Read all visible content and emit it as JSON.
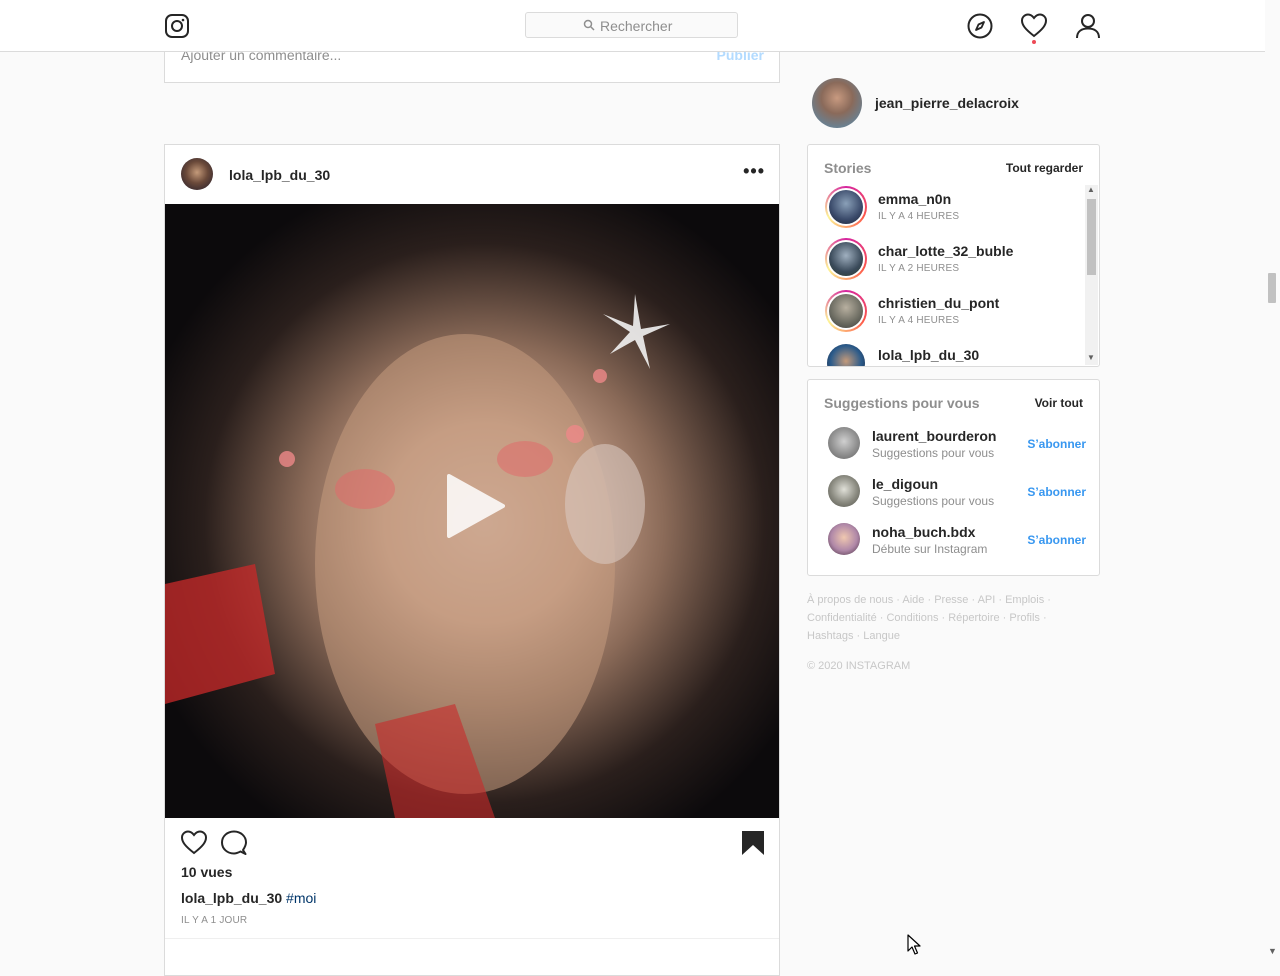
{
  "header": {
    "search_placeholder": "Rechercher",
    "icons": [
      "instagram-logo-icon",
      "compass-icon",
      "heart-icon",
      "user-icon"
    ]
  },
  "prev_post": {
    "comment_placeholder": "Ajouter un commentaire...",
    "publish_label": "Publier"
  },
  "post": {
    "username": "lola_lpb_du_30",
    "more_label": "···",
    "views": "10 vues",
    "caption_user": "lola_lpb_du_30",
    "caption_tag": "#moi",
    "time": "IL Y A 1 JOUR"
  },
  "me": {
    "username": "jean_pierre_delacroix"
  },
  "stories": {
    "title": "Stories",
    "link": "Tout regarder",
    "items": [
      {
        "name": "emma_n0n",
        "time": "IL Y A 4 HEURES"
      },
      {
        "name": "char_lotte_32_buble",
        "time": "IL Y A 2 HEURES"
      },
      {
        "name": "christien_du_pont",
        "time": "IL Y A 4 HEURES"
      },
      {
        "name": "lola_lpb_du_30",
        "time": ""
      }
    ]
  },
  "suggestions": {
    "title": "Suggestions pour vous",
    "link": "Voir tout",
    "items": [
      {
        "name": "laurent_bourderon",
        "sub": "Suggestions pour vous",
        "action": "S’abonner"
      },
      {
        "name": "le_digoun",
        "sub": "Suggestions pour vous",
        "action": "S’abonner"
      },
      {
        "name": "noha_buch.bdx",
        "sub": "Débute sur Instagram",
        "action": "S’abonner"
      }
    ]
  },
  "footer": {
    "line1": "À propos de nous · Aide · Presse · API · Emplois ·",
    "line2": "Confidentialité · Conditions · Répertoire · Profils ·",
    "line3": "Hashtags · Langue",
    "copyright": "© 2020 INSTAGRAM"
  },
  "colors": {
    "link_blue": "#3897f0",
    "hashtag": "#003569",
    "border": "#dbdbdb"
  }
}
